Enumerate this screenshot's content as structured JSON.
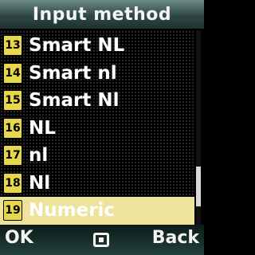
{
  "title": "Input method",
  "items": [
    {
      "number": "13",
      "label": "Smart NL",
      "selected": false
    },
    {
      "number": "14",
      "label": "Smart nl",
      "selected": false
    },
    {
      "number": "15",
      "label": "Smart Nl",
      "selected": false
    },
    {
      "number": "16",
      "label": "NL",
      "selected": false
    },
    {
      "number": "17",
      "label": "nl",
      "selected": false
    },
    {
      "number": "18",
      "label": "Nl",
      "selected": false
    },
    {
      "number": "19",
      "label": "Numeric",
      "selected": true
    }
  ],
  "softkeys": {
    "left": "OK",
    "center_icon": "menu-square-icon",
    "right": "Back"
  },
  "colors": {
    "highlight": "#ede39a",
    "badge": "#e6d84a"
  },
  "scroll": {
    "position": 0.88
  }
}
